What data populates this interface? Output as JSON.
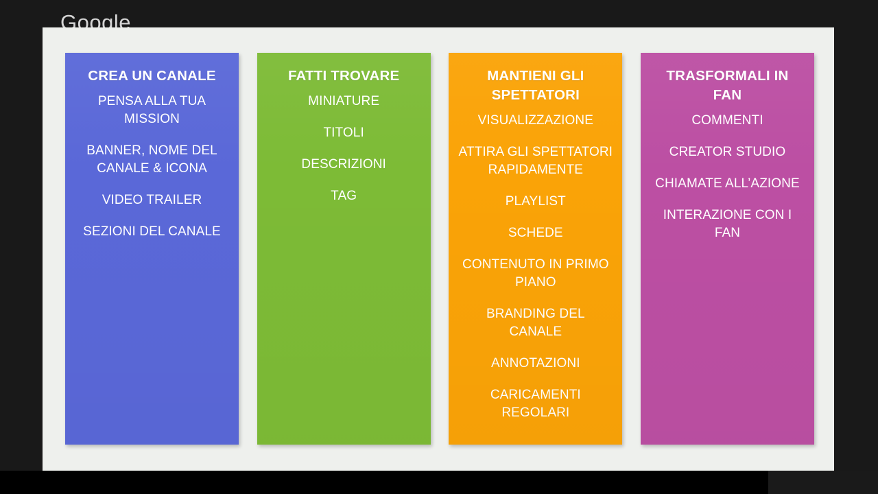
{
  "watermark": {
    "text": "Google"
  },
  "slide": {
    "background_color": "#eef0ed",
    "frame_color": "#191919",
    "columns": [
      {
        "id": "crea-un-canale",
        "title": "CREA UN CANALE",
        "color": "#5a68d8",
        "items": [
          "PENSA ALLA TUA MISSION",
          "BANNER, NOME DEL CANALE &  ICONA",
          "VIDEO TRAILER",
          "SEZIONI DEL CANALE"
        ]
      },
      {
        "id": "fatti-trovare",
        "title": "FATTI TROVARE",
        "color": "#7dbb36",
        "items": [
          "MINIATURE",
          "TITOLI",
          "DESCRIZIONI",
          "TAG"
        ]
      },
      {
        "id": "mantieni-gli-spettatori",
        "title": "MANTIENI GLI SPETTATORI",
        "color": "#faa307",
        "items": [
          "VISUALIZZAZIONE",
          "ATTIRA GLI SPETTATORI RAPIDAMENTE",
          "PLAYLIST",
          "SCHEDE",
          "CONTENUTO IN PRIMO PIANO",
          "BRANDING DEL CANALE",
          "ANNOTAZIONI",
          "CARICAMENTI REGOLARI"
        ]
      },
      {
        "id": "trasformali-in-fan",
        "title": "TRASFORMALI IN FAN",
        "color": "#bc4fa3",
        "items": [
          "COMMENTI",
          "CREATOR STUDIO",
          "CHIAMATE ALL’AZIONE",
          "INTERAZIONE CON I FAN"
        ]
      }
    ]
  }
}
